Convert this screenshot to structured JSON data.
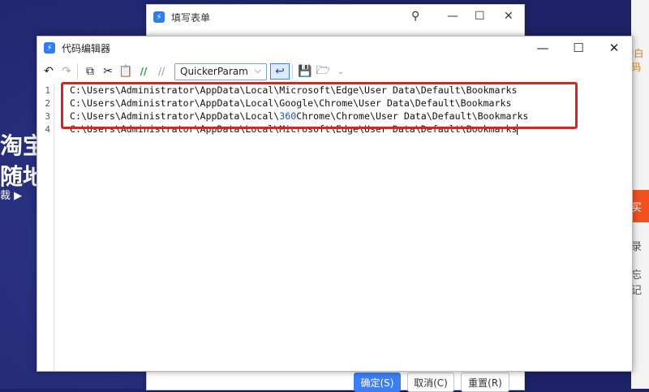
{
  "background": {
    "text_1": "淘宝",
    "text_2": "随地",
    "text_3": "裁 ▶"
  },
  "right_panel": {
    "top_label": "l白码",
    "orange_label": "买",
    "label_1": "录",
    "label_2": "忘记"
  },
  "back_window": {
    "title": "填写表单",
    "buttons": {
      "confirm": "确定(S)",
      "cancel": "取消(C)",
      "reset": "重置(R)"
    }
  },
  "editor": {
    "title": "代码编辑器",
    "toolbar": {
      "language": "QuickerParam"
    },
    "lines": [
      {
        "number": "1",
        "text": "C:\\Users\\Administrator\\AppData\\Local\\Microsoft\\Edge\\User Data\\Default\\Bookmarks"
      },
      {
        "number": "2",
        "text": "C:\\Users\\Administrator\\AppData\\Local\\Google\\Chrome\\User Data\\Default\\Bookmarks"
      },
      {
        "number": "3",
        "text_before": "C:\\Users\\Administrator\\AppData\\Local\\",
        "number_token": "360",
        "text_after": "Chrome\\Chrome\\User Data\\Default\\Bookmarks"
      },
      {
        "number": "4",
        "text": "C:\\Users\\Administrator\\AppData\\Local\\Microsoft\\Edge\\User Data\\Default\\Bookmarks"
      }
    ]
  },
  "colors": {
    "accent": "#3c7ff5",
    "highlight_box": "#e0221d",
    "number_token": "#1f55d1"
  }
}
